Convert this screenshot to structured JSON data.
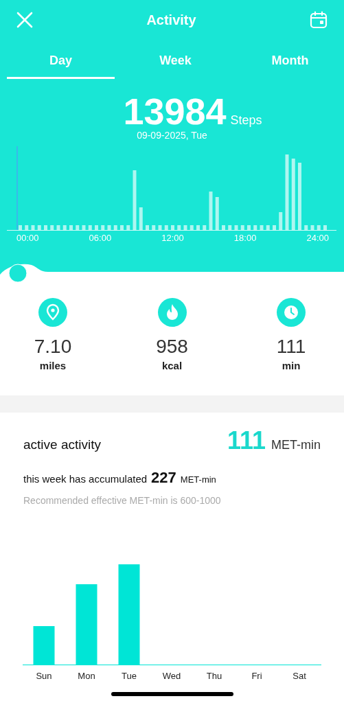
{
  "header": {
    "title": "Activity"
  },
  "tabs": [
    {
      "label": "Day",
      "selected": true
    },
    {
      "label": "Week",
      "selected": false
    },
    {
      "label": "Month",
      "selected": false
    }
  ],
  "summary": {
    "steps": "13984",
    "unit": "Steps",
    "date": "09-09-2025, Tue"
  },
  "hourly_axis": [
    "00:00",
    "06:00",
    "12:00",
    "18:00",
    "24:00"
  ],
  "stats": [
    {
      "kind": "distance",
      "value": "7.10",
      "unit": "miles"
    },
    {
      "kind": "calories",
      "value": "958",
      "unit": "kcal"
    },
    {
      "kind": "duration",
      "value": "111",
      "unit": "min"
    }
  ],
  "active_activity": {
    "title": "active activity",
    "value": "111",
    "unit": "MET-min",
    "week_text": "this week has accumulated",
    "week_value": "227",
    "week_unit": "MET-min",
    "note": "Recommended effective MET-min is 600-1000"
  },
  "week_days": [
    "Sun",
    "Mon",
    "Tue",
    "Wed",
    "Thu",
    "Fri",
    "Sat"
  ]
}
